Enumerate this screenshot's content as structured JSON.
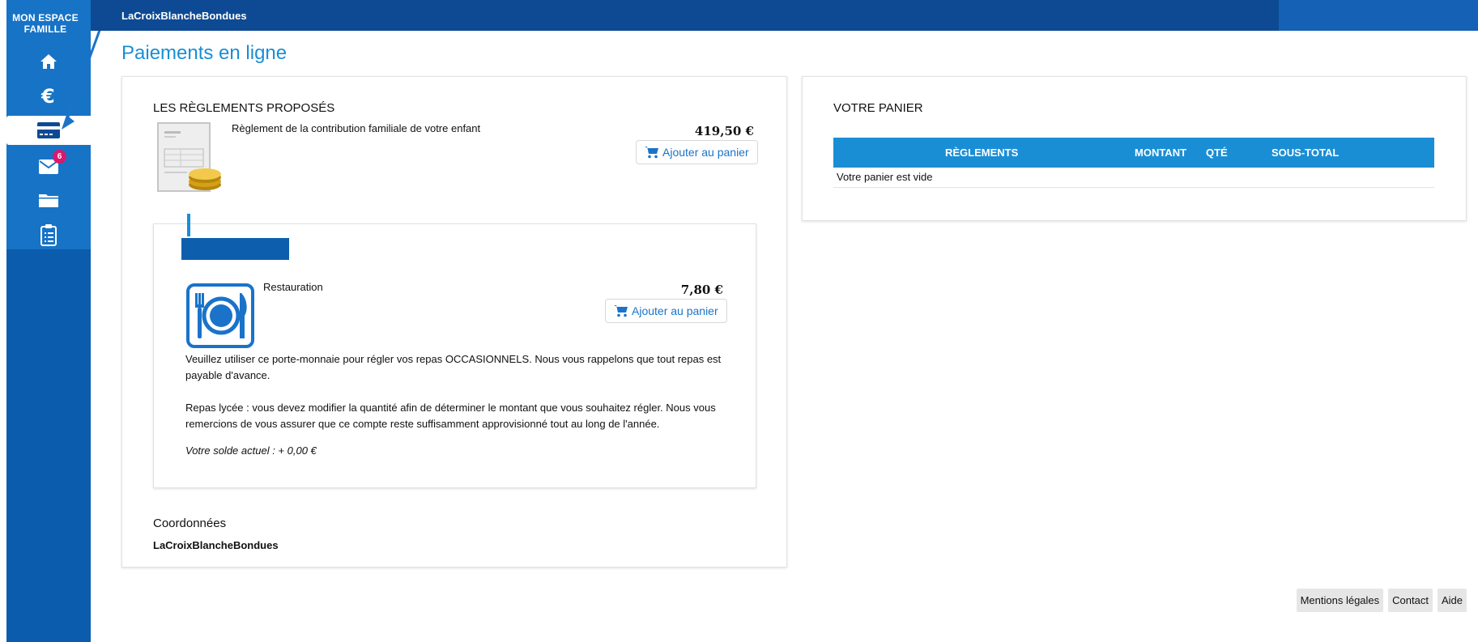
{
  "sidebar": {
    "brand": "MON ESPACE FAMILLE",
    "items": [
      {
        "icon": "home-icon"
      },
      {
        "icon": "euro-icon"
      },
      {
        "icon": "card-icon"
      },
      {
        "icon": "mail-icon",
        "badge": "6"
      },
      {
        "icon": "folder-icon"
      },
      {
        "icon": "clipboard-icon"
      }
    ]
  },
  "header": {
    "site_name": "LaCroixBlancheBondues"
  },
  "page": {
    "title": "Paiements en ligne"
  },
  "payments": {
    "section_title": "LES RÈGLEMENTS PROPOSÉS",
    "items": [
      {
        "description": "Règlement de la contribution familiale de votre enfant",
        "price": "419,50 €",
        "button": "Ajouter au panier"
      },
      {
        "description": "Restauration",
        "price": "7,80 €",
        "button": "Ajouter au panier",
        "para1": "Veuillez utiliser ce porte-monnaie pour régler vos repas OCCASIONNELS. Nous vous rappelons que tout repas est payable d'avance.",
        "para2": "Repas lycée : vous devez modifier la quantité afin de déterminer le montant que vous souhaitez régler. Nous vous remercions de vous assurer que ce compte reste suffisamment approvisionné tout au long de l'année.",
        "balance": "Votre solde actuel : + 0,00 €"
      }
    ],
    "contact_title": "Coordonnées",
    "contact_name": "LaCroixBlancheBondues"
  },
  "cart": {
    "title": "VOTRE PANIER",
    "columns": [
      "RÈGLEMENTS",
      "MONTANT",
      "QTÉ",
      "SOUS-TOTAL"
    ],
    "empty_text": "Votre panier est vide"
  },
  "footer": {
    "links": [
      "Mentions légales",
      "Contact",
      "Aide"
    ]
  },
  "colors": {
    "accent": "#1a8ed5",
    "topbar": "#0d4a93",
    "sidebar": "#0b5cad",
    "badge": "#d9196c"
  }
}
